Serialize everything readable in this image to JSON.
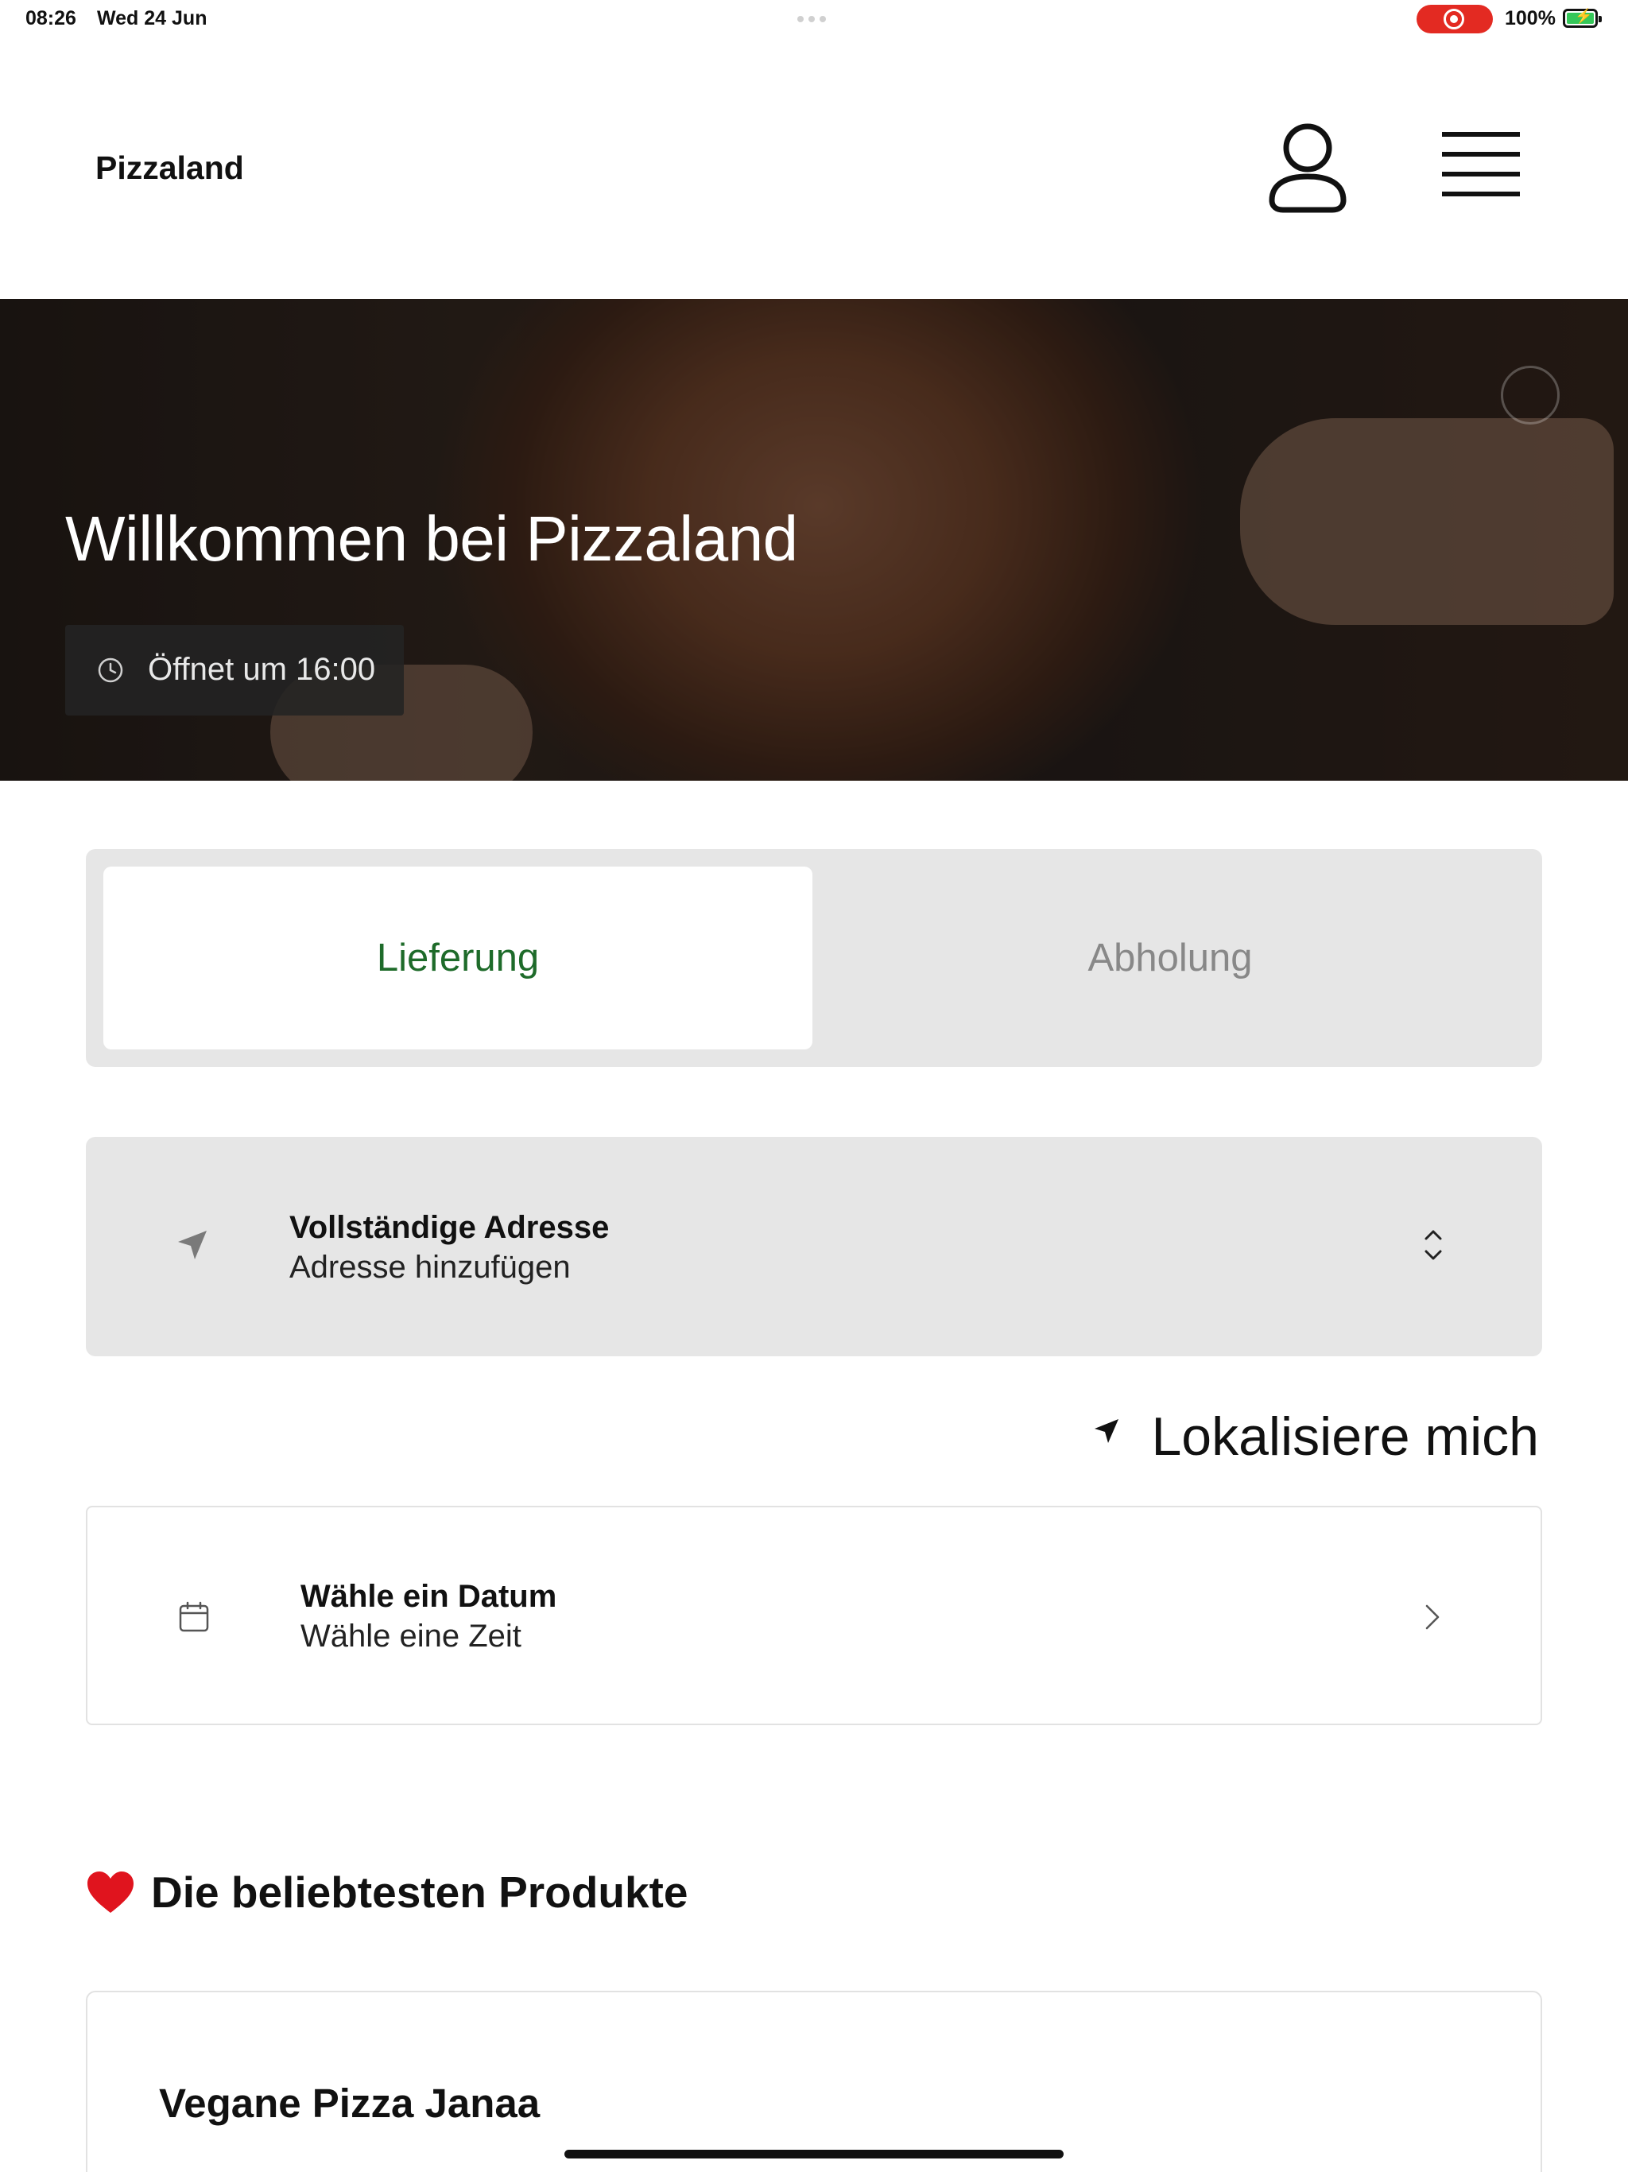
{
  "status_bar": {
    "time": "08:26",
    "date": "Wed 24 Jun",
    "battery_percent": "100%",
    "recording_color": "#e32a22"
  },
  "header": {
    "brand": "Pizzaland",
    "user_icon": "user-icon",
    "menu_icon": "hamburger-menu-icon"
  },
  "hero": {
    "title": "Willkommen bei Pizzaland",
    "hours": "Öffnet um 16:00",
    "hours_icon": "clock-icon"
  },
  "order_mode": {
    "options": [
      "Lieferung",
      "Abholung"
    ],
    "selected": "Lieferung",
    "active_color": "#1e6b2a"
  },
  "address": {
    "title": "Vollständige Adresse",
    "subtitle": "Adresse hinzufügen",
    "icon": "location-arrow-icon"
  },
  "locate": {
    "label": "Lokalisiere mich",
    "icon": "location-arrow-icon"
  },
  "schedule": {
    "title": "Wähle ein Datum",
    "subtitle": "Wähle eine Zeit",
    "icon": "calendar-icon"
  },
  "popular": {
    "heading": "Die beliebtesten Produkte",
    "heading_icon": "heart-icon",
    "products": [
      {
        "name": "Vegane Pizza Janaa"
      }
    ]
  }
}
